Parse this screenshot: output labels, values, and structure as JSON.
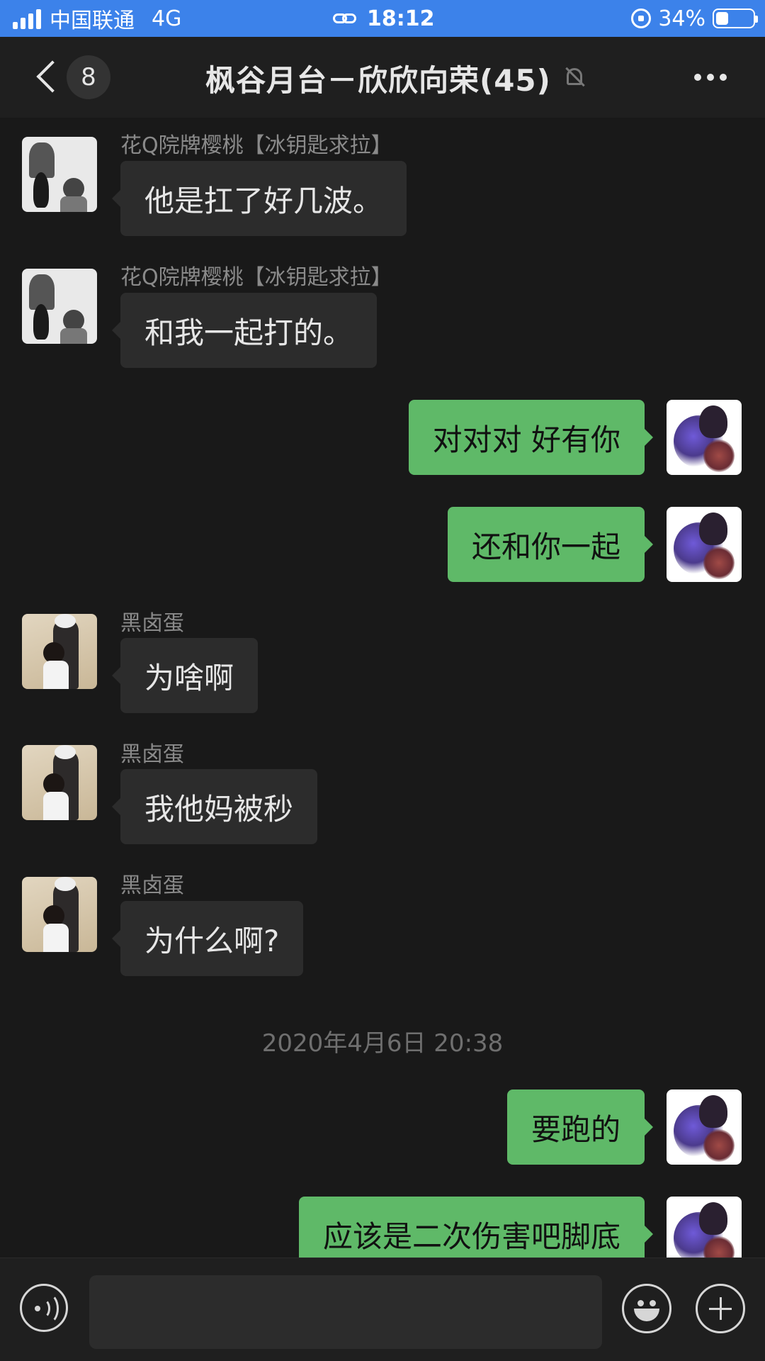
{
  "status_bar": {
    "carrier": "中国联通",
    "network": "4G",
    "time": "18:12",
    "battery_percent_text": "34%",
    "battery_level": 0.34,
    "icons": [
      "signal-icon",
      "link-icon",
      "rotation-lock-icon",
      "battery-icon"
    ]
  },
  "header": {
    "unread_count": "8",
    "title": "枫谷月台－欣欣向荣(45)",
    "icons": [
      "back-icon",
      "mute-icon",
      "more-icon"
    ]
  },
  "messages": [
    {
      "direction": "in",
      "sender": "花Q院牌樱桃【冰钥匙求拉】",
      "text": "他是扛了好几波。",
      "avatar": "manga-avatar"
    },
    {
      "direction": "in",
      "sender": "花Q院牌樱桃【冰钥匙求拉】",
      "text": "和我一起打的。",
      "avatar": "manga-avatar"
    },
    {
      "direction": "out",
      "text": "对对对 好有你",
      "avatar": "self-avatar"
    },
    {
      "direction": "out",
      "text": "还和你一起",
      "avatar": "self-avatar"
    },
    {
      "direction": "in",
      "sender": "黑卤蛋",
      "text": "为啥啊",
      "avatar": "photo-avatar"
    },
    {
      "direction": "in",
      "sender": "黑卤蛋",
      "text": "我他妈被秒",
      "avatar": "photo-avatar"
    },
    {
      "direction": "in",
      "sender": "黑卤蛋",
      "text": "为什么啊?",
      "avatar": "photo-avatar"
    }
  ],
  "timestamp": "2020年4月6日 20:38",
  "messages_after": [
    {
      "direction": "out",
      "text": "要跑的",
      "avatar": "self-avatar"
    },
    {
      "direction": "out",
      "text": "应该是二次伤害吧脚底",
      "avatar": "self-avatar"
    }
  ],
  "input_bar": {
    "value": "",
    "icons": [
      "voice-icon",
      "emoji-icon",
      "plus-icon"
    ]
  },
  "colors": {
    "status_bar": "#3c82ea",
    "background": "#191919",
    "incoming_bubble": "#2c2c2c",
    "outgoing_bubble": "#5fb968"
  }
}
